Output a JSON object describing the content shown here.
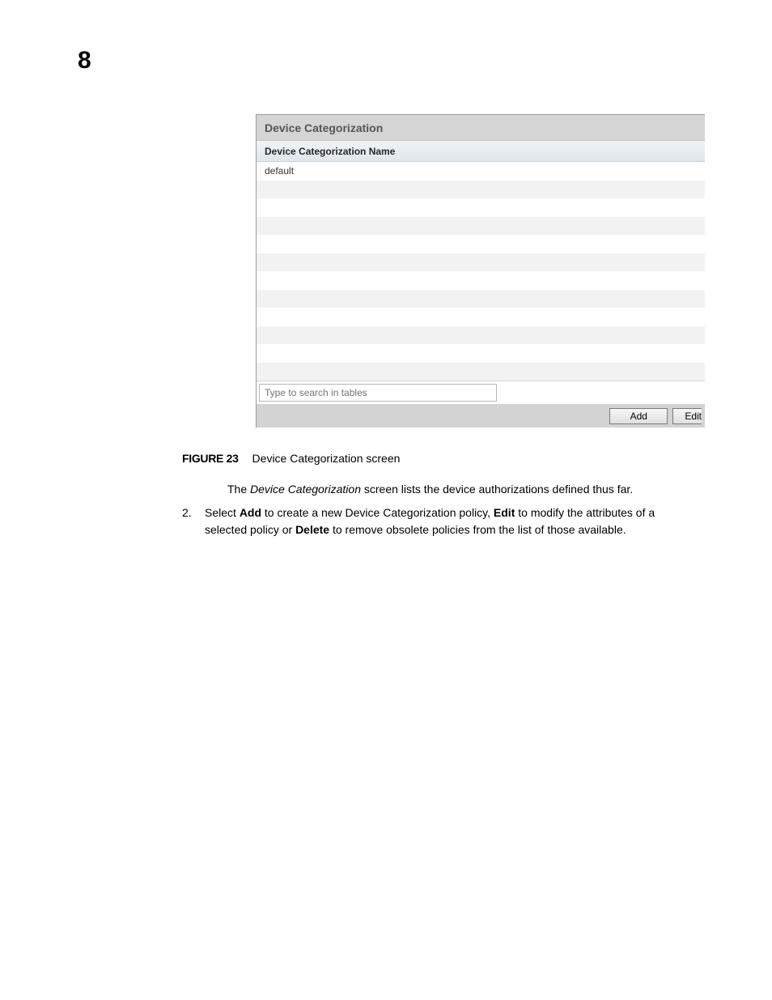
{
  "page_number": "8",
  "panel": {
    "title": "Device Categorization",
    "column_header": "Device Categorization Name",
    "rows": [
      "default",
      "",
      "",
      "",
      "",
      "",
      "",
      "",
      "",
      "",
      "",
      ""
    ],
    "search_placeholder": "Type to search in tables",
    "buttons": {
      "add": "Add",
      "edit": "Edit"
    }
  },
  "caption": {
    "label": "FIGURE 23",
    "text": "Device Categorization screen"
  },
  "desc": {
    "prefix": "The ",
    "italic": "Device Categorization",
    "suffix": " screen lists the device authorizations defined thus far."
  },
  "step": {
    "num": "2.",
    "p1a": "Select ",
    "b1": "Add",
    "p1b": " to create a new Device Categorization policy, ",
    "b2": "Edit",
    "p1c": " to modify the attributes of a selected policy or ",
    "b3": "Delete",
    "p1d": " to remove obsolete policies from the list of those available."
  }
}
